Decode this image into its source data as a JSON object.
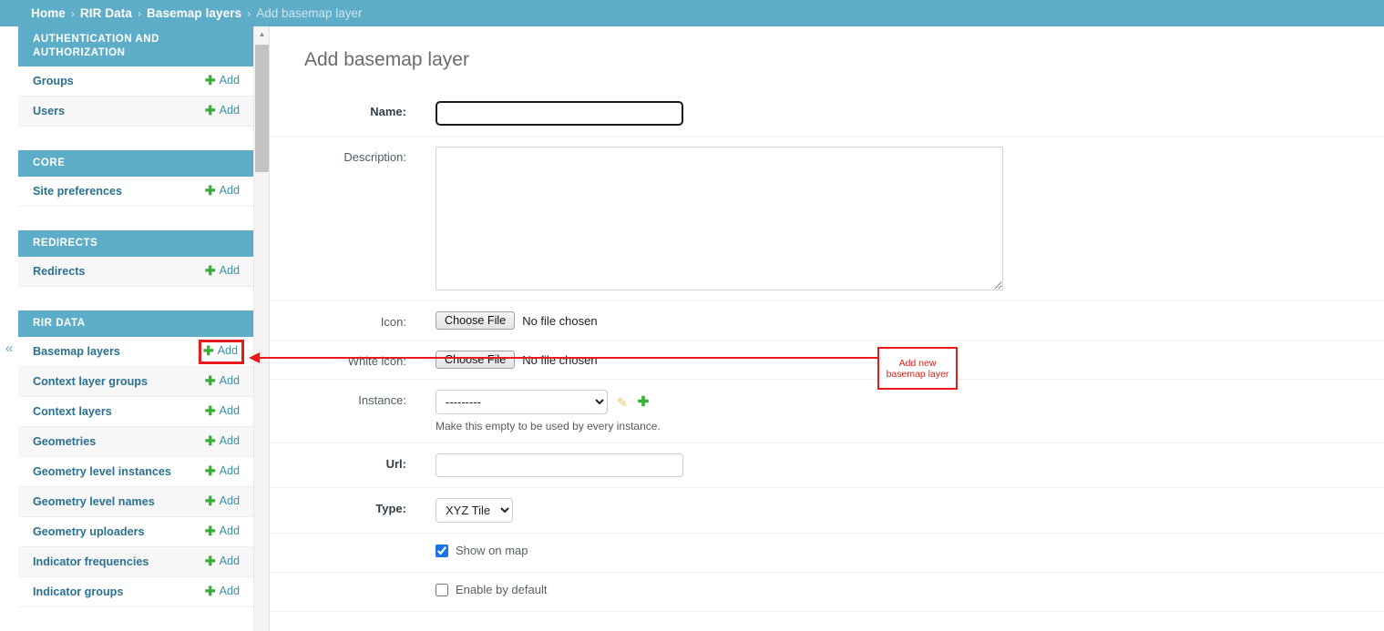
{
  "breadcrumb": {
    "items": [
      {
        "label": "Home",
        "current": false
      },
      {
        "label": "RIR Data",
        "current": false
      },
      {
        "label": "Basemap layers",
        "current": false
      },
      {
        "label": "Add basemap layer",
        "current": true
      }
    ],
    "separator": "›"
  },
  "colors": {
    "header_teal": "#5eadc8",
    "link_blue": "#2a7191",
    "add_green": "#35b035",
    "annotation_red": "#e81b1b",
    "checkbox_blue": "#1a73e8"
  },
  "sidebar": {
    "collapse_glyph": "«",
    "add_label": "Add",
    "plus_glyph": "✚",
    "scrollbar_up_glyph": "▲",
    "groups": [
      {
        "title": "Authentication and authorization",
        "models": [
          {
            "name": "Groups",
            "add": "Add",
            "highlighted": false
          },
          {
            "name": "Users",
            "add": "Add",
            "highlighted": false
          }
        ]
      },
      {
        "title": "Core",
        "models": [
          {
            "name": "Site preferences",
            "add": "Add",
            "highlighted": false
          }
        ]
      },
      {
        "title": "Redirects",
        "models": [
          {
            "name": "Redirects",
            "add": "Add",
            "highlighted": false
          }
        ]
      },
      {
        "title": "RIR Data",
        "models": [
          {
            "name": "Basemap layers",
            "add": "Add",
            "highlighted": true
          },
          {
            "name": "Context layer groups",
            "add": "Add",
            "highlighted": false
          },
          {
            "name": "Context layers",
            "add": "Add",
            "highlighted": false
          },
          {
            "name": "Geometries",
            "add": "Add",
            "highlighted": false
          },
          {
            "name": "Geometry level instances",
            "add": "Add",
            "highlighted": false
          },
          {
            "name": "Geometry level names",
            "add": "Add",
            "highlighted": false
          },
          {
            "name": "Geometry uploaders",
            "add": "Add",
            "highlighted": false
          },
          {
            "name": "Indicator frequencies",
            "add": "Add",
            "highlighted": false
          },
          {
            "name": "Indicator groups",
            "add": "Add",
            "highlighted": false
          }
        ]
      }
    ]
  },
  "main": {
    "title": "Add basemap layer",
    "fields": {
      "name": {
        "label": "Name:",
        "value": "",
        "placeholder": ""
      },
      "description": {
        "label": "Description:",
        "value": "",
        "placeholder": ""
      },
      "icon": {
        "label": "Icon:",
        "button": "Choose File",
        "status": "No file chosen"
      },
      "white_icon": {
        "label": "White icon:",
        "button": "Choose File",
        "status": "No file chosen"
      },
      "instance": {
        "label": "Instance:",
        "selected": "---------",
        "options": [
          "---------"
        ],
        "help": "Make this empty to be used by every instance.",
        "edit_icon": "✎",
        "add_icon": "✚"
      },
      "url": {
        "label": "Url:",
        "value": "",
        "placeholder": ""
      },
      "type": {
        "label": "Type:",
        "selected": "XYZ Tile",
        "options": [
          "XYZ Tile"
        ]
      },
      "show_on_map": {
        "label": "Show on map",
        "checked": true
      },
      "enable_by_default": {
        "label": "Enable by default",
        "checked": false
      }
    }
  },
  "annotation": {
    "callout_text": "Add new basemap layer"
  }
}
